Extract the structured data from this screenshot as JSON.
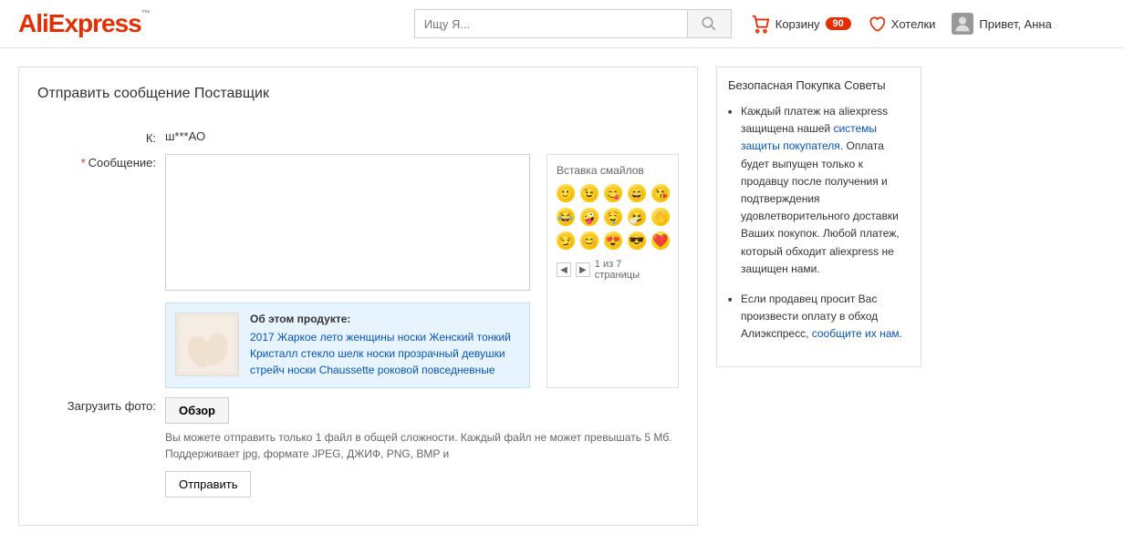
{
  "header": {
    "logo": "AliExpress",
    "search_placeholder": "Ищу Я...",
    "cart_label": "Корзину",
    "cart_count": "90",
    "wishlist_label": "Хотелки",
    "greeting": "Привет, Анна"
  },
  "main": {
    "title": "Отправить сообщение Поставщик",
    "to_label": "К:",
    "recipient": "ш***АО",
    "message_label": "Сообщение:",
    "emoji": {
      "title": "Вставка смайлов",
      "prev": "◀",
      "next": "▶",
      "pager": "1 из 7 страницы"
    },
    "product": {
      "about": "Об этом продукте:",
      "link": "2017 Жаркое лето женщины носки Женский тонкий Кристалл стекло шелк носки прозрачный девушки стрейч носки Chaussette роковой повседневные"
    },
    "upload_label": "Загрузить фото:",
    "browse_btn": "Обзор",
    "upload_hint1": "Вы можете отправить только 1 файл в общей сложности. Каждый файл не может превышать 5 Мб.",
    "upload_hint2": "Поддерживает jpg, формате JPEG, ДЖИФ, PNG, BMP и",
    "submit_btn": "Отправить"
  },
  "sidebar": {
    "title": "Безопасная Покупка Советы",
    "tip1_a": "Каждый платеж на aliexpress защищена нашей ",
    "tip1_link": "системы защиты покупателя",
    "tip1_b": ". Оплата будет выпущен только к продавцу после получения и подтверждения удовлетворительного доставки Ваших покупок. Любой платеж, который обходит aliexpress не защищен нами.",
    "tip2_a": "Если продавец просит Вас произвести оплату в обход Алиэкспресс, ",
    "tip2_link": "сообщите их нам",
    "tip2_b": "."
  }
}
